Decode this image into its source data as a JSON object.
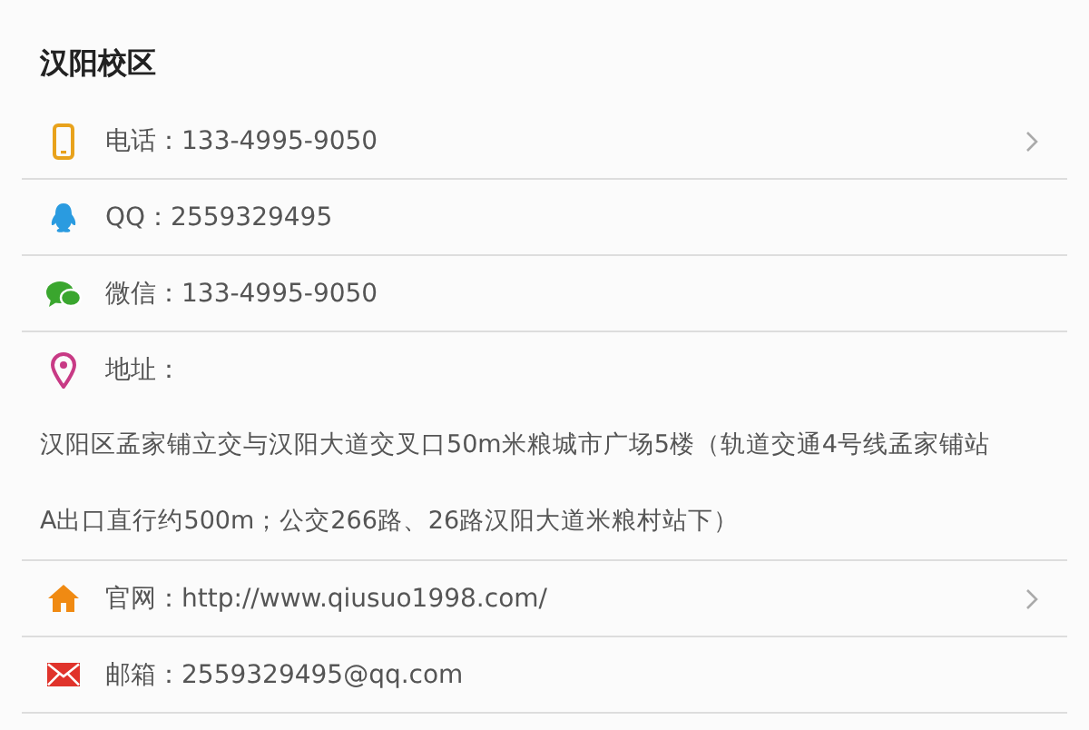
{
  "title": "汉阳校区",
  "rows": [
    {
      "kind": "phone",
      "text": "电话：133-4995-9050",
      "chevron": true
    },
    {
      "kind": "qq",
      "text": "QQ：2559329495",
      "chevron": false
    },
    {
      "kind": "chat",
      "text": "微信：133-4995-9050",
      "chevron": false
    },
    {
      "kind": "pin",
      "text": "地址：",
      "chevron": false,
      "lines": [
        "汉阳区孟家铺立交与汉阳大道交叉口50m米粮城市广场5楼（轨道交通4号线孟家铺站",
        "A出口直行约500m；公交266路、26路汉阳大道米粮村站下）"
      ]
    },
    {
      "kind": "home",
      "text": "官网：http://www.qiusuo1998.com/",
      "chevron": true
    },
    {
      "kind": "mail",
      "text": "邮箱：2559329495@qq.com",
      "chevron": false
    }
  ]
}
